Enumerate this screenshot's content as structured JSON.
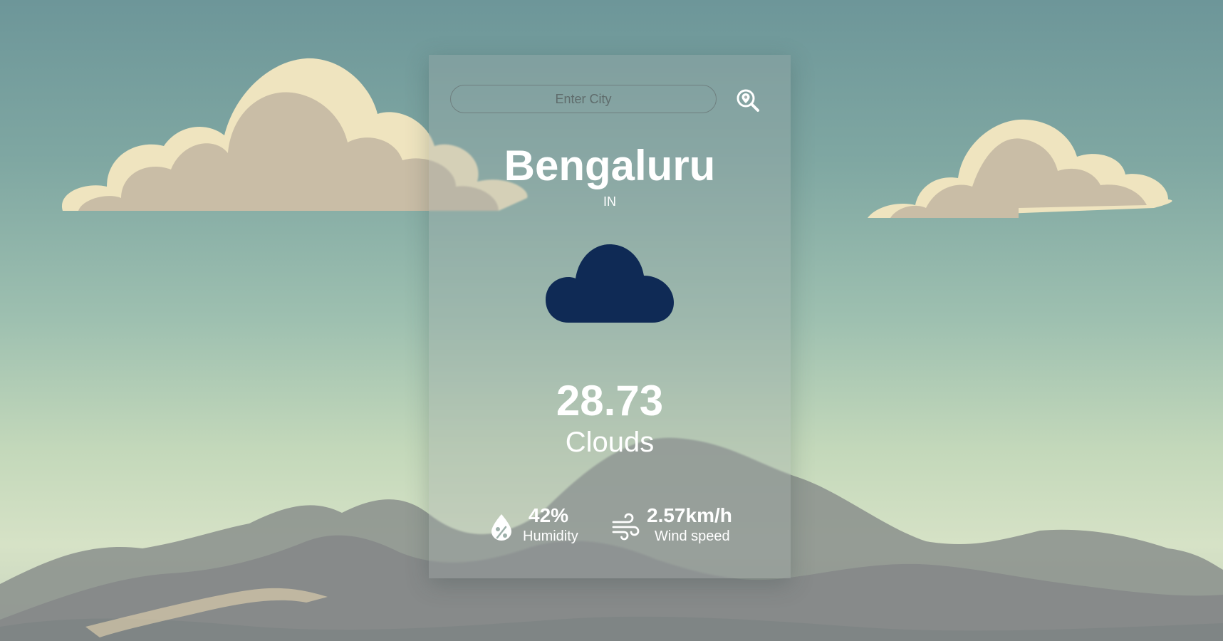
{
  "search": {
    "placeholder": "Enter City",
    "value": ""
  },
  "location": {
    "city": "Bengaluru",
    "country": "IN"
  },
  "weather": {
    "temperature": "28.73",
    "condition": "Clouds",
    "icon": "cloud-icon",
    "icon_color": "#0f2a55"
  },
  "stats": {
    "humidity": {
      "value": "42%",
      "label": "Humidity",
      "icon": "humidity-icon"
    },
    "wind": {
      "value": "2.57km/h",
      "label": "Wind speed",
      "icon": "wind-icon"
    }
  },
  "icons": {
    "search": "location-search-icon"
  },
  "colors": {
    "text": "#ffffff",
    "card_tint": "#a0a8a8",
    "cloud_icon": "#0f2a55"
  }
}
